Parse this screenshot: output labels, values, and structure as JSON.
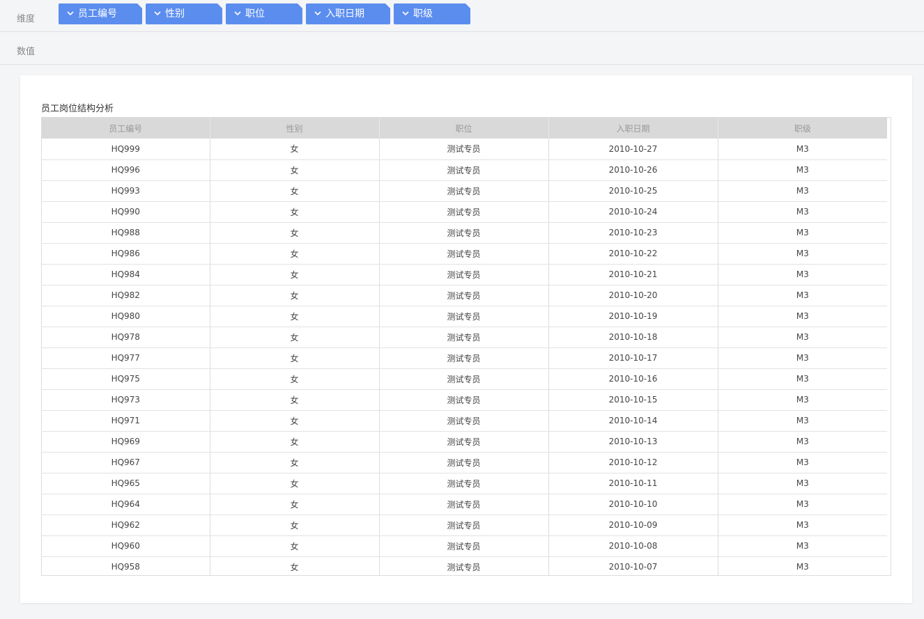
{
  "dimension_shelf": {
    "label": "维度",
    "pills": [
      {
        "label": "员工编号"
      },
      {
        "label": "性别"
      },
      {
        "label": "职位"
      },
      {
        "label": "入职日期"
      },
      {
        "label": "职级"
      }
    ]
  },
  "value_shelf": {
    "label": "数值"
  },
  "report": {
    "title": "员工岗位结构分析",
    "columns": [
      "员工编号",
      "性别",
      "职位",
      "入职日期",
      "职级"
    ],
    "rows": [
      [
        "HQ999",
        "女",
        "测试专员",
        "2010-10-27",
        "M3"
      ],
      [
        "HQ996",
        "女",
        "测试专员",
        "2010-10-26",
        "M3"
      ],
      [
        "HQ993",
        "女",
        "测试专员",
        "2010-10-25",
        "M3"
      ],
      [
        "HQ990",
        "女",
        "测试专员",
        "2010-10-24",
        "M3"
      ],
      [
        "HQ988",
        "女",
        "测试专员",
        "2010-10-23",
        "M3"
      ],
      [
        "HQ986",
        "女",
        "测试专员",
        "2010-10-22",
        "M3"
      ],
      [
        "HQ984",
        "女",
        "测试专员",
        "2010-10-21",
        "M3"
      ],
      [
        "HQ982",
        "女",
        "测试专员",
        "2010-10-20",
        "M3"
      ],
      [
        "HQ980",
        "女",
        "测试专员",
        "2010-10-19",
        "M3"
      ],
      [
        "HQ978",
        "女",
        "测试专员",
        "2010-10-18",
        "M3"
      ],
      [
        "HQ977",
        "女",
        "测试专员",
        "2010-10-17",
        "M3"
      ],
      [
        "HQ975",
        "女",
        "测试专员",
        "2010-10-16",
        "M3"
      ],
      [
        "HQ973",
        "女",
        "测试专员",
        "2010-10-15",
        "M3"
      ],
      [
        "HQ971",
        "女",
        "测试专员",
        "2010-10-14",
        "M3"
      ],
      [
        "HQ969",
        "女",
        "测试专员",
        "2010-10-13",
        "M3"
      ],
      [
        "HQ967",
        "女",
        "测试专员",
        "2010-10-12",
        "M3"
      ],
      [
        "HQ965",
        "女",
        "测试专员",
        "2010-10-11",
        "M3"
      ],
      [
        "HQ964",
        "女",
        "测试专员",
        "2010-10-10",
        "M3"
      ],
      [
        "HQ962",
        "女",
        "测试专员",
        "2010-10-09",
        "M3"
      ],
      [
        "HQ960",
        "女",
        "测试专员",
        "2010-10-08",
        "M3"
      ],
      [
        "HQ958",
        "女",
        "测试专员",
        "2010-10-07",
        "M3"
      ]
    ]
  },
  "colors": {
    "pill_bg": "#5b8def",
    "page_bg": "#f4f5f7",
    "header_bg": "#d9d9d9"
  }
}
